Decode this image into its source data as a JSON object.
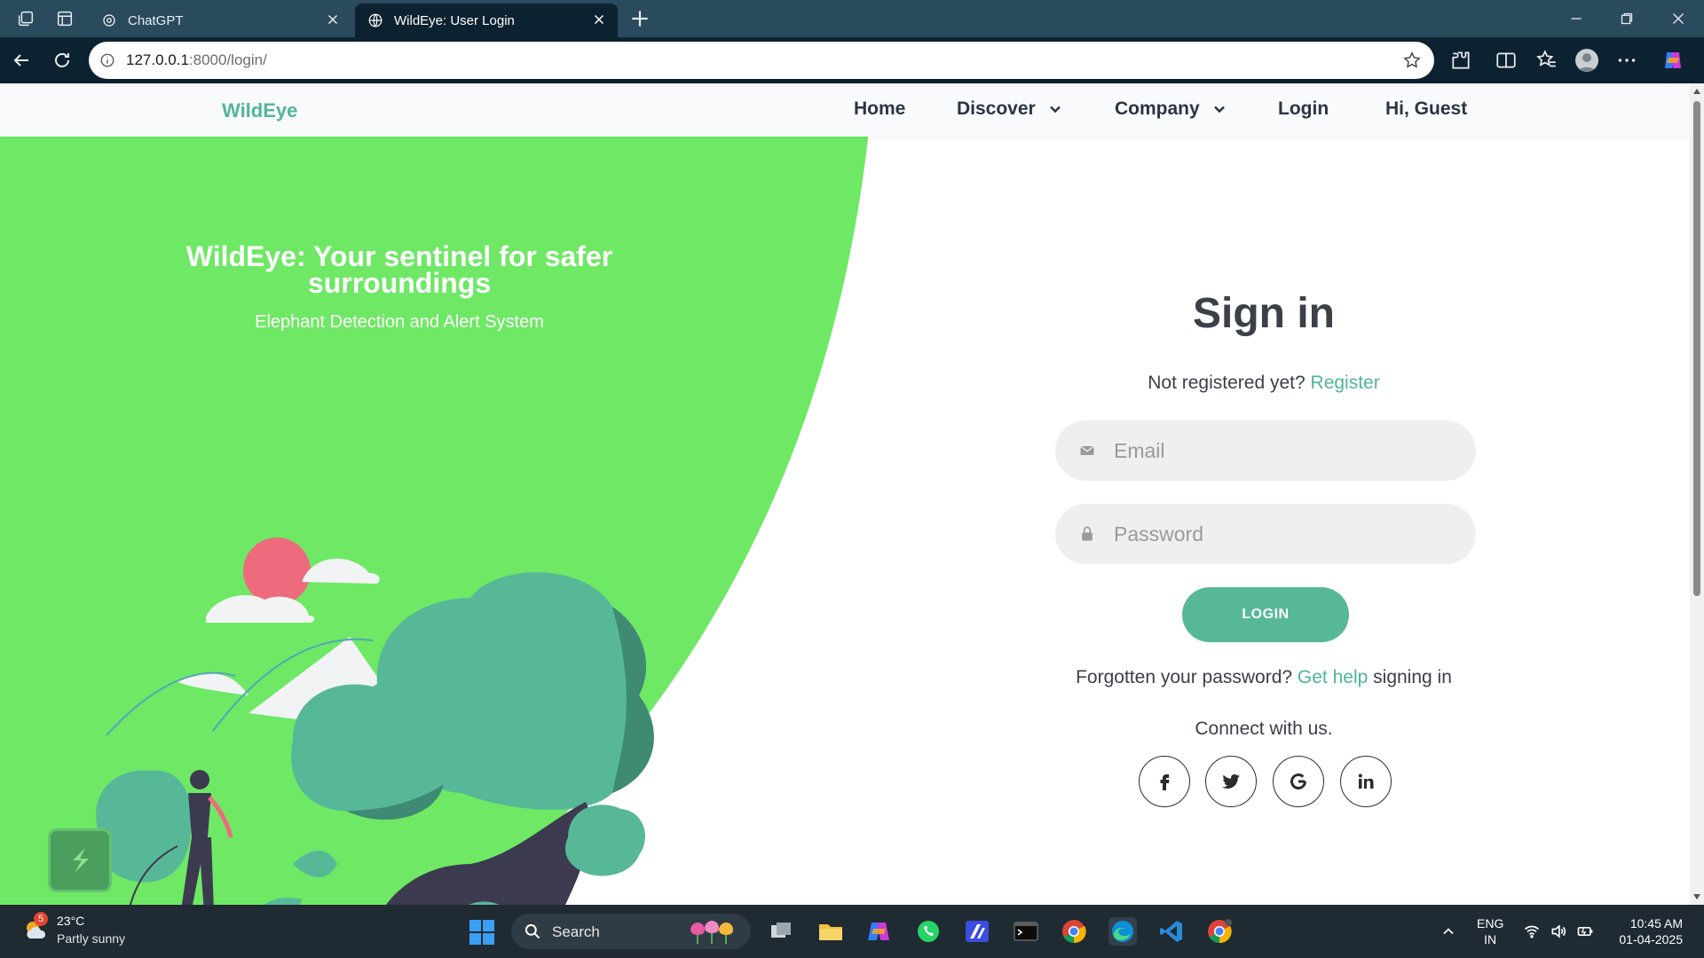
{
  "browser": {
    "tabs": [
      {
        "title": "ChatGPT",
        "active": false
      },
      {
        "title": "WildEye: User Login",
        "active": true
      }
    ],
    "url_host": "127.0.0.1",
    "url_path": ":8000/login/"
  },
  "site": {
    "brand": "WildEye",
    "nav": {
      "home": "Home",
      "discover": "Discover",
      "company": "Company",
      "login": "Login",
      "greeting": "Hi, Guest"
    },
    "hero": {
      "title": "WildEye: Your sentinel for safer surroundings",
      "subtitle": "Elephant Detection and Alert System"
    },
    "signin": {
      "title": "Sign in",
      "not_registered": "Not registered yet?",
      "register_link": "Register",
      "email_placeholder": "Email",
      "password_placeholder": "Password",
      "login_button": "LOGIN",
      "forgot_prefix": "Forgotten your password?",
      "forgot_link": "Get help",
      "forgot_suffix": "signing in",
      "connect": "Connect with us.",
      "socials": [
        "facebook",
        "twitter",
        "google",
        "linkedin"
      ]
    },
    "colors": {
      "accent": "#52b597",
      "hero_green": "#6ee865",
      "button": "#57b898"
    }
  },
  "taskbar": {
    "weather_badge": "5",
    "temperature": "23°C",
    "condition": "Partly sunny",
    "search_label": "Search",
    "lang_line1": "ENG",
    "lang_line2": "IN",
    "time": "10:45 AM",
    "date": "01-04-2025"
  }
}
